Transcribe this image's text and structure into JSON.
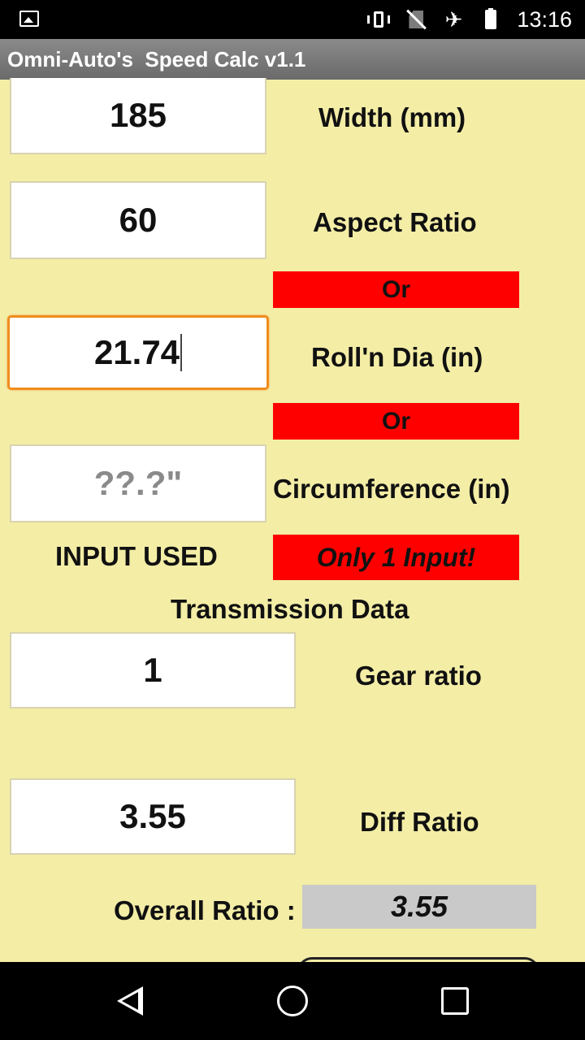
{
  "status": {
    "time": "13:16"
  },
  "app": {
    "title": "Omni-Auto's  Speed Calc v1.1"
  },
  "tire": {
    "width_value": "185",
    "width_label": "Width (mm)",
    "aspect_value": "60",
    "aspect_label": "Aspect Ratio",
    "or1": "Or",
    "dia_value": "21.74",
    "dia_label": "Roll'n Dia (in)",
    "or2": "Or",
    "circ_placeholder": "??.?\"",
    "circ_label": "Circumference (in)",
    "input_used_label": "INPUT USED",
    "input_used_value": "Only 1 Input!"
  },
  "transmission": {
    "heading": "Transmission Data",
    "gear_value": "1",
    "gear_label": "Gear ratio",
    "diff_value": "3.55",
    "diff_label": "Diff Ratio",
    "overall_label": "Overall Ratio :",
    "overall_value": "3.55"
  },
  "colors": {
    "background": "#f3eda6",
    "alert": "#ff0000",
    "focus": "#f08c1e"
  }
}
